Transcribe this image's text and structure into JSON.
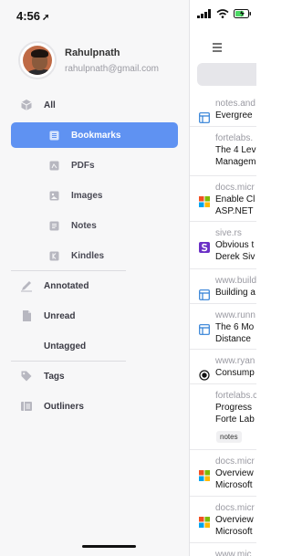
{
  "status": {
    "time": "4:56"
  },
  "profile": {
    "name": "Rahulpnath",
    "email": "rahulpnath@gmail.com"
  },
  "nav": {
    "all": "All",
    "bookmarks": "Bookmarks",
    "pdfs": "PDFs",
    "images": "Images",
    "notes": "Notes",
    "kindles": "Kindles",
    "annotated": "Annotated",
    "unread": "Unread",
    "untagged": "Untagged",
    "tags": "Tags",
    "outliners": "Outliners"
  },
  "list": [
    {
      "domain": "notes.and",
      "title1": "Evergree",
      "title2": "",
      "icon": "bookmark-icon"
    },
    {
      "domain": "fortelabs.",
      "title1": "The 4 Lev",
      "title2": "Managem",
      "icon": "none"
    },
    {
      "domain": "docs.micr",
      "title1": "Enable Cl",
      "title2": "ASP.NET",
      "icon": "microsoft-icon"
    },
    {
      "domain": "sive.rs",
      "title1": "Obvious t",
      "title2": "Derek Siv",
      "icon": "sive-icon"
    },
    {
      "domain": "www.build",
      "title1": "Building a",
      "title2": "",
      "icon": "bookmark-icon"
    },
    {
      "domain": "www.runn",
      "title1": "The 6 Mo",
      "title2": "Distance",
      "icon": "bookmark-icon"
    },
    {
      "domain": "www.ryan",
      "title1": "Consump",
      "title2": "",
      "icon": "record-icon"
    },
    {
      "domain": "fortelabs.c",
      "title1": "Progress",
      "title2": "Forte Lab",
      "icon": "none",
      "tag": "notes"
    },
    {
      "domain": "docs.micr",
      "title1": "Overview",
      "title2": "Microsoft",
      "icon": "microsoft-icon"
    },
    {
      "domain": "docs.micr",
      "title1": "Overview",
      "title2": "Microsoft",
      "icon": "microsoft-icon"
    },
    {
      "domain": "www.mic",
      "title1": "",
      "title2": "",
      "icon": "none"
    }
  ],
  "colors": {
    "accent": "#5f92f2",
    "link_icon": "#2f7fd6"
  }
}
